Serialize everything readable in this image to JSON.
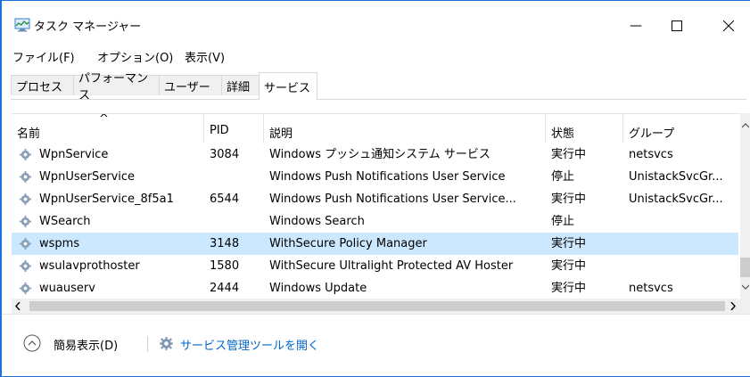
{
  "window": {
    "title": "タスク マネージャー",
    "minimize_glyph": "—",
    "maximize_glyph": "☐",
    "close_glyph": "✕"
  },
  "menu": [
    "ファイル(F)",
    "オプション(O)",
    "表示(V)"
  ],
  "tabs": [
    {
      "label": "プロセス",
      "active": false
    },
    {
      "label": "パフォーマンス",
      "active": false
    },
    {
      "label": "ユーザー",
      "active": false
    },
    {
      "label": "詳細",
      "active": false
    },
    {
      "label": "サービス",
      "active": true
    }
  ],
  "table": {
    "sort_indicator": "^",
    "columns": [
      "名前",
      "PID",
      "説明",
      "状態",
      "グループ"
    ],
    "rows": [
      {
        "name": "WpnService",
        "pid": "3084",
        "desc": "Windows プッシュ通知システム サービス",
        "status": "実行中",
        "group": "netsvcs",
        "selected": false
      },
      {
        "name": "WpnUserService",
        "pid": "",
        "desc": "Windows Push Notifications User Service",
        "status": "停止",
        "group": "UnistackSvcGr...",
        "selected": false
      },
      {
        "name": "WpnUserService_8f5a1",
        "pid": "6544",
        "desc": "Windows Push Notifications User Service...",
        "status": "実行中",
        "group": "UnistackSvcGr...",
        "selected": false
      },
      {
        "name": "WSearch",
        "pid": "",
        "desc": "Windows Search",
        "status": "停止",
        "group": "",
        "selected": false
      },
      {
        "name": "wspms",
        "pid": "3148",
        "desc": "WithSecure Policy Manager",
        "status": "実行中",
        "group": "",
        "selected": true
      },
      {
        "name": "wsulavprothoster",
        "pid": "1580",
        "desc": "WithSecure Ultralight Protected AV Hoster",
        "status": "実行中",
        "group": "",
        "selected": false
      },
      {
        "name": "wuauserv",
        "pid": "2444",
        "desc": "Windows Update",
        "status": "実行中",
        "group": "netsvcs",
        "selected": false
      }
    ]
  },
  "footer": {
    "fewer_details": "簡易表示(D)",
    "open_services": "サービス管理ツールを開く"
  },
  "colors": {
    "accent": "#0066cc",
    "selected_row": "#cce8ff",
    "window_border": "#1a73d8"
  },
  "icons": {
    "app": "task-manager-icon",
    "service": "gear-icon",
    "fewer": "chevron-up-circle-icon"
  }
}
